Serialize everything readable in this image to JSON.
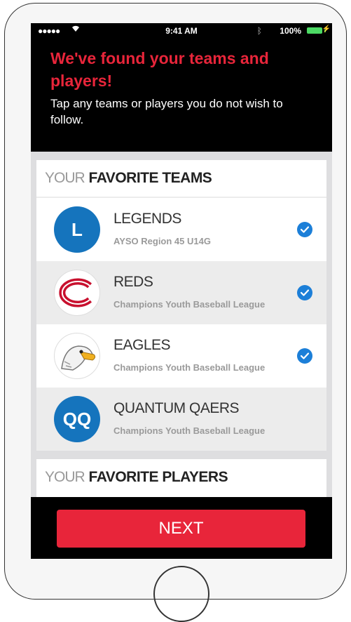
{
  "status": {
    "signal": "●●●●●",
    "time": "9:41 AM",
    "battery": "100%"
  },
  "header": {
    "title": "We've found your teams and players!",
    "subtitle": "Tap any teams or players you do not wish to follow."
  },
  "teams_section": {
    "prefix": "YOUR",
    "label": "FAVORITE TEAMS"
  },
  "teams": [
    {
      "name": "LEGENDS",
      "league": "AYSO Region 45 U14G",
      "badge": "L",
      "selected": true
    },
    {
      "name": "REDS",
      "league": "Champions Youth Baseball League",
      "badge": "",
      "selected": true
    },
    {
      "name": "EAGLES",
      "league": "Champions Youth Baseball League",
      "badge": "",
      "selected": true
    },
    {
      "name": "QUANTUM QAERS",
      "league": "Champions Youth Baseball League",
      "badge": "QQ",
      "selected": false
    }
  ],
  "players_section": {
    "prefix": "YOUR",
    "label": "FAVORITE PLAYERS"
  },
  "next_label": "NEXT",
  "colors": {
    "accent": "#e8253a",
    "check": "#1c7fd8",
    "badge": "#1574bd"
  }
}
